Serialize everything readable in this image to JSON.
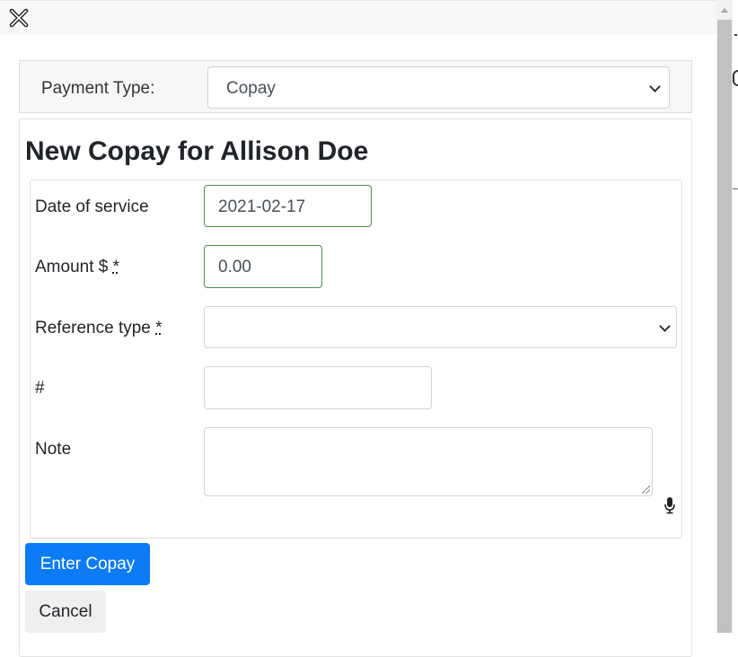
{
  "header": {
    "close_icon": "close-x-icon"
  },
  "payment_type": {
    "label": "Payment Type:",
    "selected": "Copay"
  },
  "form": {
    "title": "New Copay for Allison Doe",
    "date_of_service": {
      "label": "Date of service",
      "value": "2021-02-17"
    },
    "amount": {
      "label": "Amount $",
      "required_marker": "*",
      "value": "0.00"
    },
    "reference_type": {
      "label": "Reference type",
      "required_marker": "*",
      "selected": ""
    },
    "number": {
      "label": "#",
      "value": ""
    },
    "note": {
      "label": "Note",
      "value": ""
    },
    "mic_icon": "microphone-icon"
  },
  "actions": {
    "submit_label": "Enter Copay",
    "cancel_label": "Cancel"
  },
  "colors": {
    "primary": "#0d7bf6",
    "valid_border": "#4d8b4d",
    "secondary_bg": "#efefef"
  }
}
